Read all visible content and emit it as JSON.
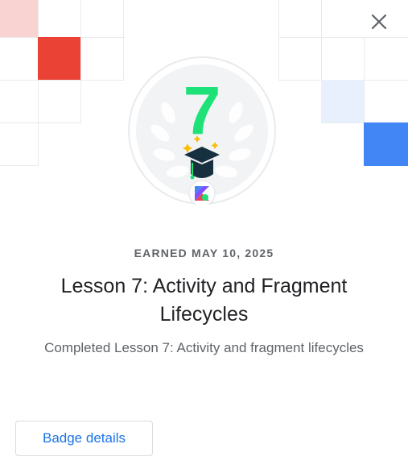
{
  "dialog": {
    "earned_label": "EARNED MAY 10, 2025",
    "title": "Lesson 7: Activity and Fragment Lifecycles",
    "description": "Completed Lesson 7: Activity and fragment lifecycles",
    "details_button_label": "Badge details",
    "close_icon": "close-icon"
  },
  "badge": {
    "number": "7",
    "number_color": "#1ee177",
    "icons": [
      "laurel-wreath-icon",
      "graduation-cap-icon",
      "kotlin-logo-icon"
    ]
  },
  "colors": {
    "accent_red": "#ea4335",
    "accent_blue": "#4285f4",
    "light_red": "#f9d3d1",
    "light_blue": "#e8f0fe",
    "grid_line": "#e8eaed",
    "link_blue": "#1a73e8"
  }
}
